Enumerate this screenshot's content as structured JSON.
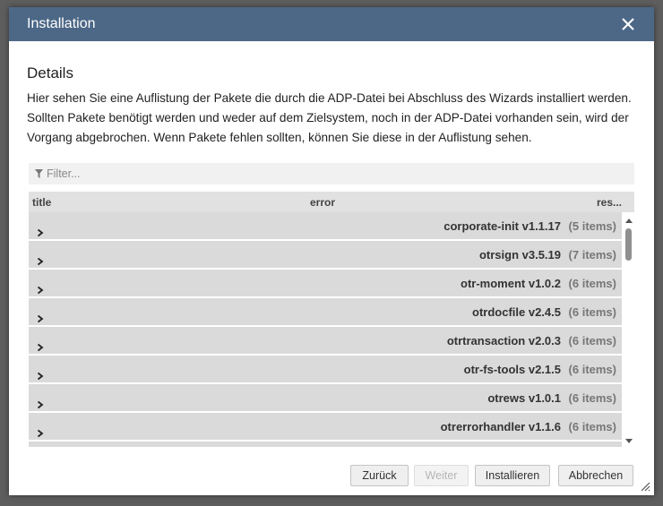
{
  "dialog": {
    "title": "Installation",
    "section_title": "Details",
    "description": "Hier sehen Sie eine Auflistung der Pakete die durch die ADP-Datei bei Abschluss des Wizards installiert werden. Sollten Pakete benötigt werden und weder auf dem Zielsystem, noch in der ADP-Datei vorhanden sein, wird der Vorgang abgebrochen. Wenn Pakete fehlen sollten, können Sie diese in der Auflistung sehen."
  },
  "filter": {
    "placeholder": "Filter...",
    "value": ""
  },
  "grid": {
    "columns": [
      "title",
      "error",
      "res..."
    ],
    "rows": [
      {
        "package": "corporate-init v1.1.17",
        "count": "(5 items)"
      },
      {
        "package": "otrsign v3.5.19",
        "count": "(7 items)"
      },
      {
        "package": "otr-moment v1.0.2",
        "count": "(6 items)"
      },
      {
        "package": "otrdocfile v2.4.5",
        "count": "(6 items)"
      },
      {
        "package": "otrtransaction v2.0.3",
        "count": "(6 items)"
      },
      {
        "package": "otr-fs-tools v2.1.5",
        "count": "(6 items)"
      },
      {
        "package": "otrews v1.0.1",
        "count": "(6 items)"
      },
      {
        "package": "otrerrorhandler v1.1.6",
        "count": "(6 items)"
      }
    ]
  },
  "buttons": {
    "back": "Zurück",
    "next": "Weiter",
    "install": "Installieren",
    "cancel": "Abbrechen"
  },
  "colors": {
    "titlebar": "#4d6887",
    "row_bg": "#dadada",
    "header_bg": "#e1e1e1"
  }
}
